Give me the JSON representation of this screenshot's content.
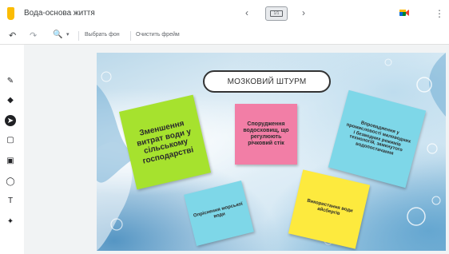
{
  "app": {
    "doc_title": "Вода-основа життя"
  },
  "frame_nav": {
    "prev_symbol": "‹",
    "frame_label": "1/1",
    "next_symbol": "›"
  },
  "toolbar": {
    "undo_symbol": "↶",
    "redo_symbol": "↷",
    "zoom_symbol": "🔍",
    "zoom_caret": "▾",
    "set_background_label": "Выбрать фон",
    "clear_frame_label": "Очистить фрейм"
  },
  "colors": {
    "accent_yellow": "#fbbc04",
    "note_green": "#a6e22e",
    "note_pink": "#f27ea6",
    "note_cyan": "#7ed7e8",
    "note_yellow": "#fdea3e"
  },
  "tools": [
    {
      "name": "pen-icon",
      "symbol": "✎"
    },
    {
      "name": "eraser-icon",
      "symbol": "◆"
    },
    {
      "name": "select-icon",
      "symbol": "➤"
    },
    {
      "name": "sticky-note-icon",
      "symbol": "▢"
    },
    {
      "name": "image-icon",
      "symbol": "▣"
    },
    {
      "name": "circle-icon",
      "symbol": "◯"
    },
    {
      "name": "text-box-icon",
      "symbol": "T"
    },
    {
      "name": "laser-icon",
      "symbol": "✦"
    }
  ],
  "canvas": {
    "title": "МОЗКОВИЙ ШТУРМ",
    "notes": {
      "green": "Зменшення витрат води у сільському господарстві",
      "pink": "Спорудження водосховищ, що регулюють річковий стік",
      "cyan_right": "Впровадження у промисловості маловодних і безводних режимів технологій, замкнутого водопостачання",
      "cyan_bottom": "Опріснення морської води",
      "yellow": "Використання води айсбергів"
    }
  }
}
